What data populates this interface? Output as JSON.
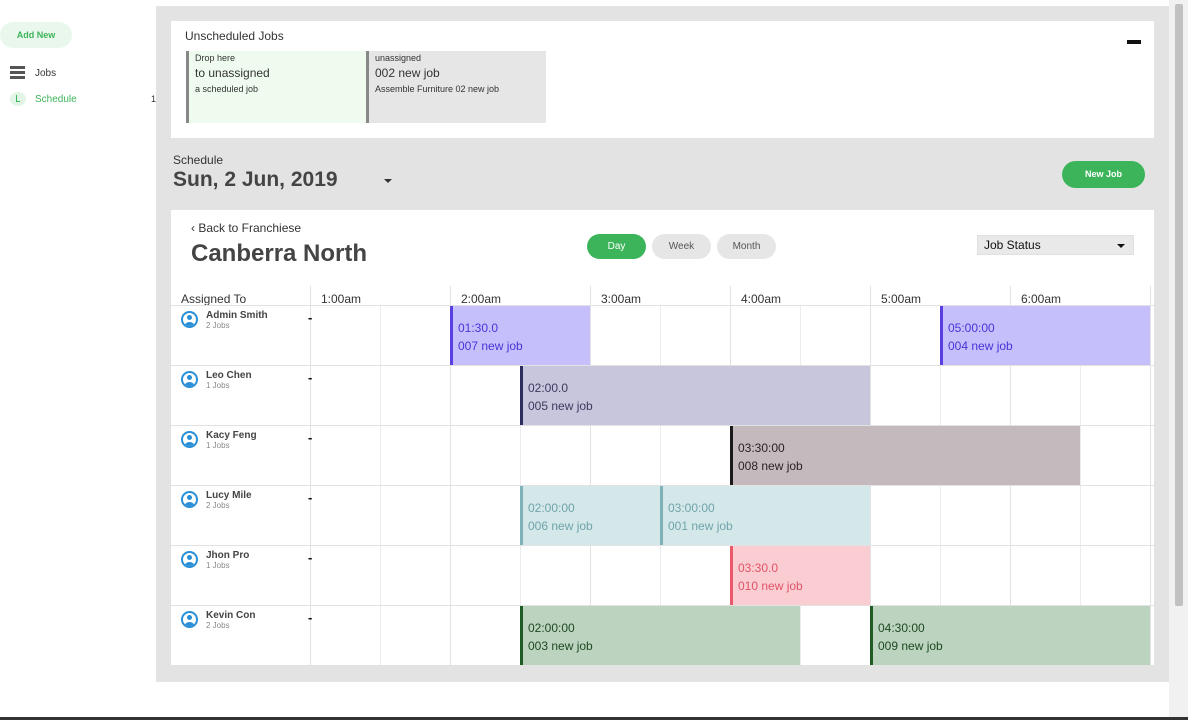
{
  "sidebar": {
    "add_new": "Add New",
    "items": [
      {
        "label": "Jobs",
        "icon": "list-icon"
      },
      {
        "label": "Schedule",
        "icon": "clock-icon"
      }
    ],
    "schedule_badge": "1"
  },
  "unscheduled": {
    "title": "Unscheduled Jobs",
    "drop_card": {
      "line1": "Drop here",
      "line2": "to unassigned",
      "line3": "a scheduled job"
    },
    "unassigned_card": {
      "line1": "unassigned",
      "line2": "002 new job",
      "line3": "Assemble Furniture 02 new job"
    }
  },
  "schedule": {
    "label": "Schedule",
    "date": "Sun, 2 Jun, 2019",
    "new_job": "New Job"
  },
  "panel": {
    "back_link": "‹ Back to Franchiese",
    "location": "Canberra North",
    "views": {
      "day": "Day",
      "week": "Week",
      "month": "Month"
    },
    "status_select": "Job Status"
  },
  "grid": {
    "assigned_header": "Assigned To",
    "hours": [
      "1:00am",
      "2:00am",
      "3:00am",
      "4:00am",
      "5:00am",
      "6:00am"
    ],
    "rows": [
      {
        "name": "Admin Smith",
        "jobs": "2 Jobs",
        "dash": "-"
      },
      {
        "name": "Leo Chen",
        "jobs": "1 Jobs",
        "dash": "-"
      },
      {
        "name": "Kacy Feng",
        "jobs": "1 Jobs",
        "dash": "-"
      },
      {
        "name": "Lucy Mile",
        "jobs": "2 Jobs",
        "dash": "-"
      },
      {
        "name": "Jhon Pro",
        "jobs": "1 Jobs",
        "dash": "-"
      },
      {
        "name": "Kevin Con",
        "jobs": "2 Jobs",
        "dash": "-"
      }
    ],
    "jobs": [
      {
        "time": "01:30.0",
        "title": "007 new job",
        "row": 0,
        "start_hour": 1.5,
        "end_hour": 2.5,
        "bg": "#c5c0fb",
        "border": "#5a3fe0",
        "text": "#4b32d8"
      },
      {
        "time": "05:00:00",
        "title": "004 new job",
        "row": 0,
        "start_hour": 5.0,
        "end_hour": 6.5,
        "bg": "#c5c0fb",
        "border": "#5a3fe0",
        "text": "#4b32d8"
      },
      {
        "time": "02:00.0",
        "title": "005 new job",
        "row": 1,
        "start_hour": 2.0,
        "end_hour": 4.5,
        "bg": "#c8c6dc",
        "border": "#2e2e5e",
        "text": "#3a3a5e"
      },
      {
        "time": "03:30:00",
        "title": "008 new job",
        "row": 2,
        "start_hour": 3.5,
        "end_hour": 6.0,
        "bg": "#c4babe",
        "border": "#1a1a1a",
        "text": "#2a2226"
      },
      {
        "time": "02:00:00",
        "title": "006 new job",
        "row": 3,
        "start_hour": 2.0,
        "end_hour": 3.0,
        "bg": "#d4e8ea",
        "border": "#7fb2b8",
        "text": "#6fa4aa"
      },
      {
        "time": "03:00:00",
        "title": "001 new job",
        "row": 3,
        "start_hour": 3.0,
        "end_hour": 4.5,
        "bg": "#d4e8ea",
        "border": "#7fb2b8",
        "text": "#6fa4aa"
      },
      {
        "time": "03:30.0",
        "title": "010 new job",
        "row": 4,
        "start_hour": 3.5,
        "end_hour": 4.5,
        "bg": "#f9cdd2",
        "border": "#e8596b",
        "text": "#e05466"
      },
      {
        "time": "02:00:00",
        "title": "003 new job",
        "row": 5,
        "start_hour": 2.0,
        "end_hour": 4.0,
        "bg": "#bcd3bf",
        "border": "#1f5c24",
        "text": "#1d4a22"
      },
      {
        "time": "04:30:00",
        "title": "009 new job",
        "row": 5,
        "start_hour": 4.5,
        "end_hour": 6.5,
        "bg": "#bcd3bf",
        "border": "#1f5c24",
        "text": "#1d4a22"
      }
    ]
  }
}
